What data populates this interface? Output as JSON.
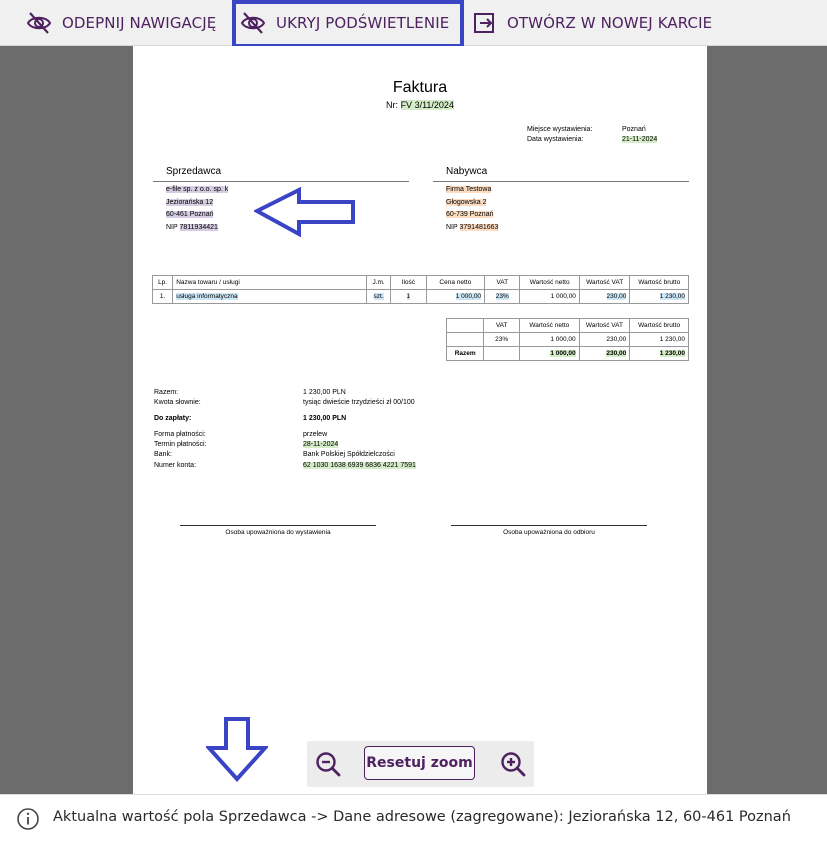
{
  "toolbar": {
    "unpin_nav_label": "ODEPNIJ NAWIGACJĘ",
    "hide_highlight_label": "UKRYJ PODŚWIETLENIE",
    "open_new_tab_label": "OTWÓRZ W NOWEJ KARCIE",
    "icons": [
      "eye-off-icon",
      "eye-off-icon",
      "open-in-new-tab-icon"
    ],
    "accent_color": "#4e2160",
    "frame_color": "#3a45c6"
  },
  "invoice": {
    "title": "Faktura",
    "number_label": "Nr:",
    "number": "FV 3/11/2024",
    "place_label": "Miejsce wystawienia:",
    "place": "Poznań",
    "date_label": "Data wystawienia:",
    "date": "21-11-2024",
    "seller": {
      "heading": "Sprzedawca",
      "name": "e-file sp. z o.o. sp. k",
      "street": "Jeziorańska 12",
      "city": "60-461 Poznań",
      "nip_label": "NIP",
      "nip": "7811934421"
    },
    "buyer": {
      "heading": "Nabywca",
      "name": "Firma Testowa",
      "street": "Głogowska 2",
      "city": "60-739 Poznań",
      "nip_label": "NIP",
      "nip": "3791481663"
    },
    "items_table": {
      "headers": [
        "Lp.",
        "Nazwa towaru / usługi",
        "J.m.",
        "Ilość",
        "Cena netto",
        "VAT",
        "Wartość netto",
        "Wartość VAT",
        "Wartość brutto"
      ],
      "rows": [
        [
          "1.",
          "usługa informatyczna",
          "szt.",
          "1",
          "1 000,00",
          "23%",
          "1 000,00",
          "230,00",
          "1 230,00"
        ]
      ]
    },
    "vat_table": {
      "headers": [
        "VAT",
        "Wartość netto",
        "Wartość VAT",
        "Wartość brutto"
      ],
      "rows": [
        [
          "",
          "23%",
          "1 000,00",
          "230,00",
          "1 230,00"
        ],
        [
          "Razem",
          "",
          "1 000,00",
          "230,00",
          "1 230,00"
        ]
      ]
    },
    "summary": {
      "total_label": "Razem:",
      "total": "1 230,00 PLN",
      "words_label": "Kwota słownie:",
      "words": "tysiąc  dwieście  trzydzieści  zł 00/100",
      "to_pay_label": "Do zapłaty:",
      "to_pay": "1 230,00 PLN",
      "payment_form_label": "Forma płatności:",
      "payment_form": "przelew",
      "due_label": "Termin płatności:",
      "due": "28-11-2024",
      "bank_label": "Bank:",
      "bank": "Bank Polskiej Spółdzielczości",
      "account_label": "Numer konta:",
      "account": "62 1030 1638 6939 6836 4221 7591"
    },
    "signatures": {
      "issuer": "Osoba upoważniona do wystawienia",
      "receiver": "Osoba upoważniona do odbioru"
    }
  },
  "zoom": {
    "reset_label": "Resetuj zoom",
    "icons": [
      "zoom-out-icon",
      "zoom-in-icon"
    ]
  },
  "info_bar": {
    "text": "Aktualna wartość pola Sprzedawca -> Dane adresowe (zagregowane): Jeziorańska 12, 60-461 Poznań",
    "icon": "info-icon"
  }
}
